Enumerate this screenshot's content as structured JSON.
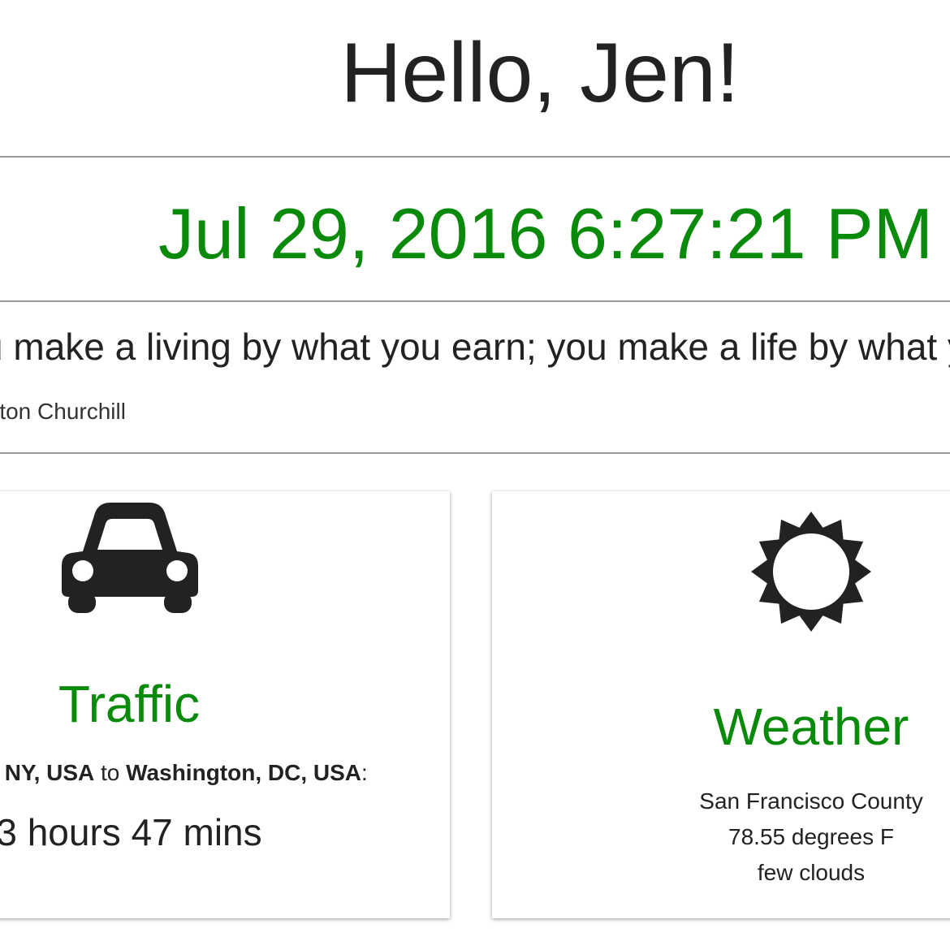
{
  "greeting": "Hello, Jen!",
  "datetime": "Jul 29, 2016 6:27:21 PM",
  "quote": {
    "text": "You make a living by what you earn; you make a life by what you give.",
    "author": "- Winston Churchill"
  },
  "traffic": {
    "title": "Traffic",
    "icon": "car-icon",
    "origin": "New York, NY, USA",
    "connector": "to",
    "destination": "Washington, DC, USA",
    "suffix": ":",
    "duration": "3 hours 47 mins"
  },
  "weather": {
    "title": "Weather",
    "icon": "sun-icon",
    "location": "San Francisco County",
    "temperature": "78.55 degrees F",
    "conditions": "few clouds"
  },
  "colors": {
    "accent": "#0a8a0a",
    "text": "#222222",
    "divider": "#9a9a9a"
  }
}
